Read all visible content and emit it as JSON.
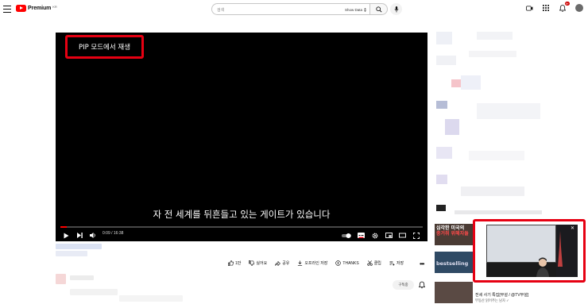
{
  "header": {
    "logo_text": "Premium",
    "logo_region": "KR",
    "search_placeholder": "검색",
    "show_data_label": "Show Data",
    "notification_count": "9+"
  },
  "player": {
    "pip_button_label": "PIP 모드에서 재생",
    "subtitle": "자 전 세계를 뒤흔들고 있는 게이트가 있습니다",
    "time": "0:09 / 16:38",
    "progress_fraction": 0.009
  },
  "actions": {
    "like_count": "1만",
    "dislike_label": "싫어요",
    "share_label": "공유",
    "offline_label": "오프라인 저장",
    "thanks_label": "THANKS",
    "clip_label": "클립",
    "save_label": "저장"
  },
  "channel": {
    "subscribe_label": "구독중"
  },
  "sidebar": {
    "thumb_titles": [
      "심각한 미국의",
      "충거쥐 위해자들"
    ],
    "thumb2_title": "bestselling",
    "pip_rec_title": "전세 사기 특집[부설 / @TV부설]",
    "pip_rec_channel": "부동산 읽어주는 남자 ✓"
  },
  "colors": {
    "accent_red": "#ff0000",
    "highlight_box": "#e60012"
  }
}
